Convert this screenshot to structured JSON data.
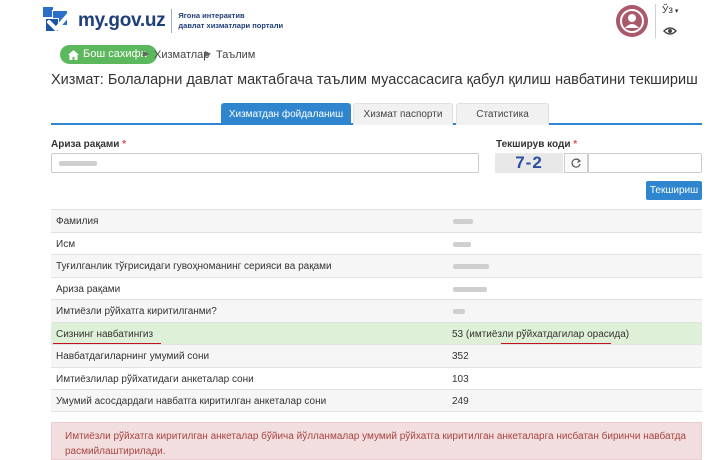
{
  "header": {
    "logo_name": "my.gov.uz",
    "logo_tagline_1": "Ягона интерактив",
    "logo_tagline_2": "давлат хизматлари портали",
    "lang": "Ўз"
  },
  "breadcrumb": {
    "home": "Бош сахифа",
    "items": [
      "Хизматлар",
      "Таълим"
    ]
  },
  "page_title": "Хизмат: Болаларни давлат мактабгача таълим муассасасига қабул қилиш навбатини текшириш",
  "tabs": [
    {
      "label": "Хизматдан фойдаланиш",
      "active": true
    },
    {
      "label": "Хизмат паспорти",
      "active": false
    },
    {
      "label": "Статистика",
      "active": false
    }
  ],
  "form": {
    "application_label": "Ариза рақами",
    "captcha_label": "Текширув коди",
    "required_mark": "*",
    "captcha_text": "7-2",
    "check_button": "Текшириш"
  },
  "results": [
    {
      "label": "Фамилия",
      "value": ""
    },
    {
      "label": "Исм",
      "value": ""
    },
    {
      "label": "Туғилганлик тўғрисидаги гувоҳноманинг серияси ва рақами",
      "value": ""
    },
    {
      "label": "Ариза рақами",
      "value": ""
    },
    {
      "label": "Имтиёзли рўйхатга киритилганми?",
      "value": ""
    },
    {
      "label": "Сизнинг навбатингиз",
      "value": "53 (имтиёзли рўйхатдагилар орасида)"
    },
    {
      "label": "Навбатдагиларнинг умумий сони",
      "value": "352"
    },
    {
      "label": "Имтиёзлилар рўйхатидаги анкеталар сони",
      "value": "103"
    },
    {
      "label": "Умумий асосдардаги навбатга киритилган анкеталар сони",
      "value": "249"
    }
  ],
  "alert": {
    "text": "Имтиёзли рўйхатга киритилган анкеталар бўйича йўлланмалар умумий рўйхатга киритилган анкеталарга нисбатан биринчи навбатда расмийлаштирилади."
  },
  "colors": {
    "primary": "#2f86cf",
    "success": "#5cb85c",
    "highlight": "#dff0d8",
    "alert_bg": "#f2dede",
    "alert_text": "#a94442",
    "underline": "#c1121f"
  }
}
